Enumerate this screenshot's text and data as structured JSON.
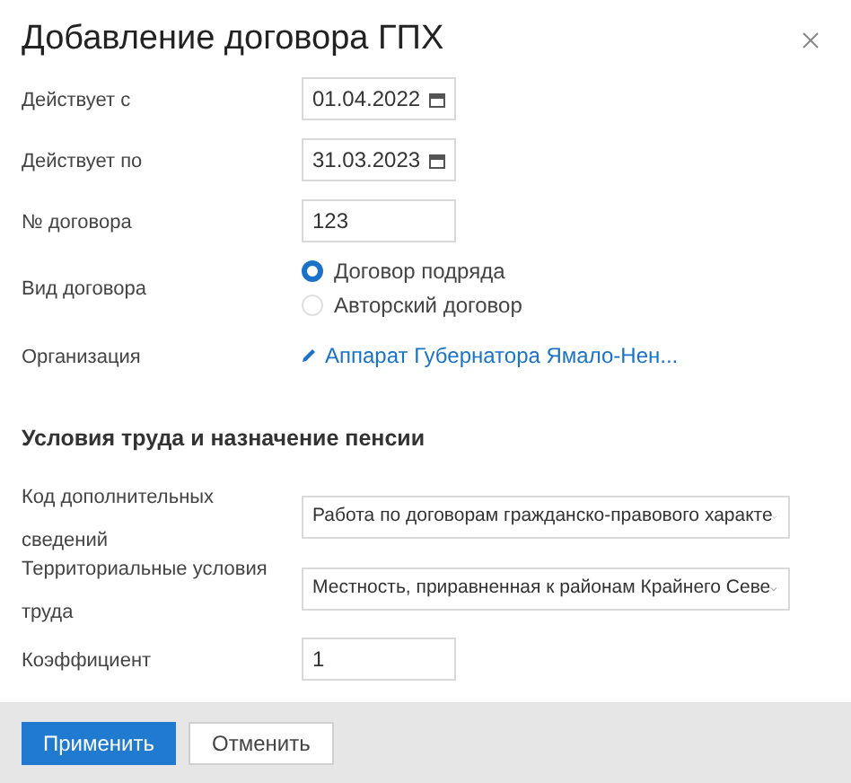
{
  "title": "Добавление договора ГПХ",
  "fields": [
    {
      "kind": "date",
      "label": "Действует с",
      "value": "01.04.2022"
    },
    {
      "kind": "date",
      "label": "Действует по",
      "value": "31.03.2023"
    },
    {
      "kind": "text",
      "label": "№ договора",
      "value": "123"
    },
    {
      "kind": "radio",
      "label": "Вид договора",
      "options": [
        {
          "label": "Договор подряда",
          "selected": true
        },
        {
          "label": "Авторский договор",
          "selected": false
        }
      ]
    },
    {
      "kind": "link",
      "label": "Организация",
      "value": "Аппарат Губернатора Ямало-Нен..."
    }
  ],
  "section": {
    "title": "Условия труда и назначение пенсии",
    "fields": [
      {
        "kind": "select",
        "label": "Код дополнительных сведений",
        "value": "Работа по договорам гражданско-правового характе"
      },
      {
        "kind": "select",
        "label": "Территориальные условия труда",
        "value": "Местность, приравненная к районам Крайнего Севе"
      },
      {
        "kind": "text",
        "label": "Коэффициент",
        "value": "1"
      }
    ]
  },
  "buttons": [
    {
      "label": "Применить",
      "kind": "primary"
    },
    {
      "label": "Отменить",
      "kind": "secondary"
    }
  ]
}
